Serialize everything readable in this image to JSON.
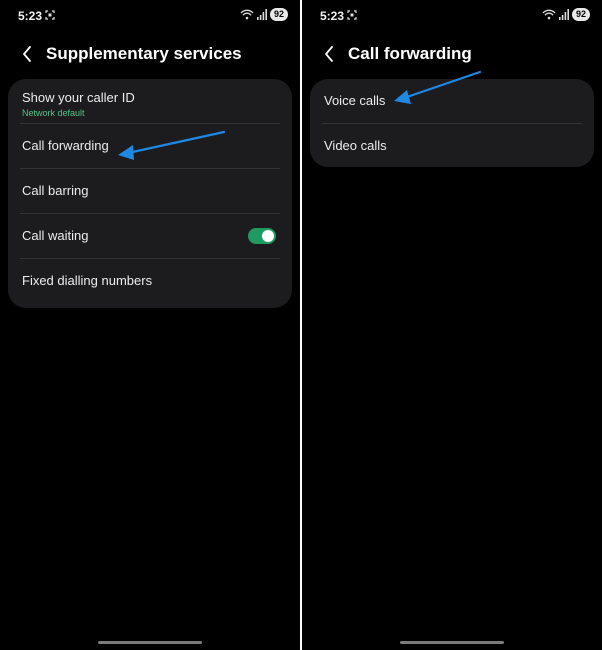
{
  "colors": {
    "accent_green": "#1f9a63",
    "subtext_green": "#4fc48a",
    "annotation_arrow": "#1e88e5",
    "card": "#1c1c1e"
  },
  "left_screen": {
    "status": {
      "time": "5:23",
      "battery": "92"
    },
    "title": "Supplementary services",
    "items": [
      {
        "label": "Show your caller ID",
        "sub": "Network default"
      },
      {
        "label": "Call forwarding"
      },
      {
        "label": "Call barring"
      },
      {
        "label": "Call waiting",
        "toggle_on": true
      },
      {
        "label": "Fixed dialling numbers"
      }
    ]
  },
  "right_screen": {
    "status": {
      "time": "5:23",
      "battery": "92"
    },
    "title": "Call forwarding",
    "items": [
      {
        "label": "Voice calls"
      },
      {
        "label": "Video calls"
      }
    ]
  },
  "icons": [
    "screenshot-icon",
    "wifi-calling-icon",
    "signal-icon",
    "battery-icon",
    "back-arrow-icon",
    "annotation-arrow-icon"
  ]
}
